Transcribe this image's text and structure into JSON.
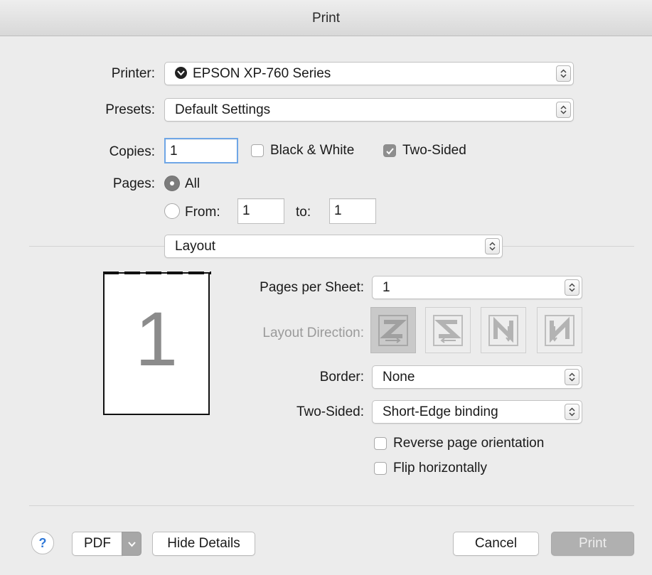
{
  "window": {
    "title": "Print"
  },
  "printer": {
    "label": "Printer:",
    "value": "EPSON XP-760 Series"
  },
  "presets": {
    "label": "Presets:",
    "value": "Default Settings"
  },
  "copies": {
    "label": "Copies:",
    "value": "1",
    "black_white_label": "Black & White",
    "black_white_checked": false,
    "two_sided_label": "Two-Sided",
    "two_sided_checked": true
  },
  "pages": {
    "label": "Pages:",
    "all_label": "All",
    "from_label": "From:",
    "from_value": "1",
    "to_label": "to:",
    "to_value": "1"
  },
  "section": {
    "value": "Layout"
  },
  "layout": {
    "preview_number": "1",
    "pages_per_sheet_label": "Pages per Sheet:",
    "pages_per_sheet_value": "1",
    "layout_direction_label": "Layout Direction:",
    "border_label": "Border:",
    "border_value": "None",
    "two_sided_label": "Two-Sided:",
    "two_sided_value": "Short-Edge binding",
    "reverse_label": "Reverse page orientation",
    "flip_label": "Flip horizontally"
  },
  "footer": {
    "help": "?",
    "pdf": "PDF",
    "hide_details": "Hide Details",
    "cancel": "Cancel",
    "print": "Print"
  }
}
